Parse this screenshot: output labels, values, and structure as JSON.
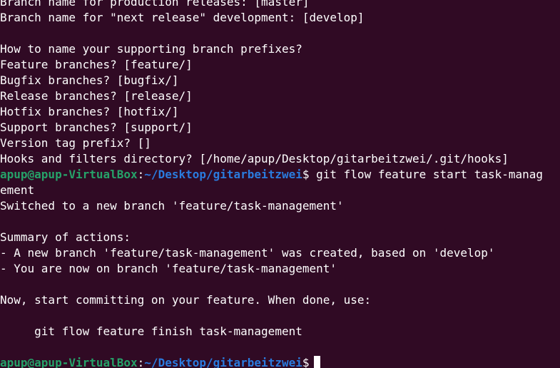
{
  "terminal": {
    "lines": [
      "Branch name for production releases: [master]",
      "Branch name for \"next release\" development: [develop]",
      "",
      "How to name your supporting branch prefixes?",
      "Feature branches? [feature/]",
      "Bugfix branches? [bugfix/]",
      "Release branches? [release/]",
      "Hotfix branches? [hotfix/]",
      "Support branches? [support/]",
      "Version tag prefix? []",
      "Hooks and filters directory? [/home/apup/Desktop/gitarbeitzwei/.git/hooks]"
    ],
    "prompt1": {
      "user": "apup@apup-VirtualBox",
      "sep": ":",
      "path": "~/Desktop/gitarbeitzwei",
      "symbol": "$",
      "command": " git flow feature start task-manag"
    },
    "wrap": "ement",
    "output": [
      "Switched to a new branch 'feature/task-management'",
      "",
      "Summary of actions:",
      "- A new branch 'feature/task-management' was created, based on 'develop'",
      "- You are now on branch 'feature/task-management'",
      "",
      "Now, start committing on your feature. When done, use:",
      "",
      "     git flow feature finish task-management",
      ""
    ],
    "prompt2": {
      "user": "apup@apup-VirtualBox",
      "sep": ":",
      "path": "~/Desktop/gitarbeitzwei",
      "symbol": "$"
    },
    "colors": {
      "background": "#300a24",
      "text": "#ffffff",
      "user": "#26a269",
      "path": "#2a7bde"
    }
  }
}
